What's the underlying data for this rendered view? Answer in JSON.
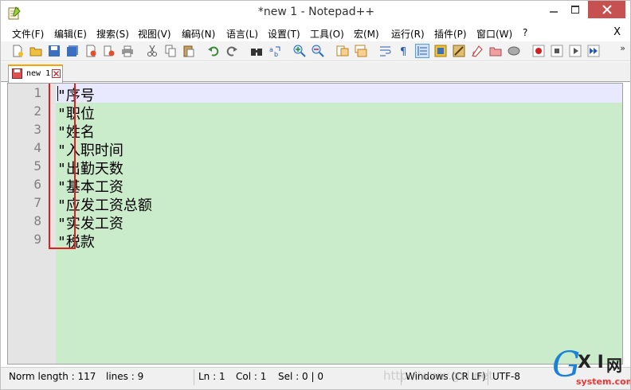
{
  "window": {
    "title": "*new 1 - Notepad++",
    "controls": {
      "minimize": "minimize",
      "maximize": "maximize",
      "close": "close"
    }
  },
  "menu": {
    "items": [
      "文件(F)",
      "编辑(E)",
      "搜索(S)",
      "视图(V)",
      "编码(N)",
      "语言(L)",
      "设置(T)",
      "工具(O)",
      "宏(M)",
      "运行(R)",
      "插件(P)",
      "窗口(W)",
      "?"
    ],
    "close_label": "X"
  },
  "toolbar": {
    "more_label": "»"
  },
  "tabs": [
    {
      "label": "new 1",
      "modified": true,
      "active": true
    }
  ],
  "editor": {
    "line_numbers": [
      "1",
      "2",
      "3",
      "4",
      "5",
      "6",
      "7",
      "8",
      "9"
    ],
    "lines": [
      "\"序号",
      "\"职位",
      "\"姓名",
      "\"入职时间",
      "\"出勤天数",
      "\"基本工资",
      "\"应发工资总额",
      "\"实发工资",
      "\"税款"
    ],
    "background_color": "#cbeccb",
    "current_line": 1
  },
  "status": {
    "length": "Norm length : 117",
    "lines": "lines : 9",
    "ln": "Ln : 1",
    "col": "Col : 1",
    "sel": "Sel : 0 | 0",
    "eol": "Windows (CR LF)",
    "encoding": "UTF-8"
  },
  "watermark": {
    "url_text": "http://www.gxl.net",
    "logo_g": "G",
    "logo_xi": "X I",
    "logo_cn": "网",
    "logo_url": "system.com"
  },
  "colors": {
    "accent_tab": "#f7a600",
    "close_button": "#c75050",
    "annotation_box": "#e02020"
  }
}
